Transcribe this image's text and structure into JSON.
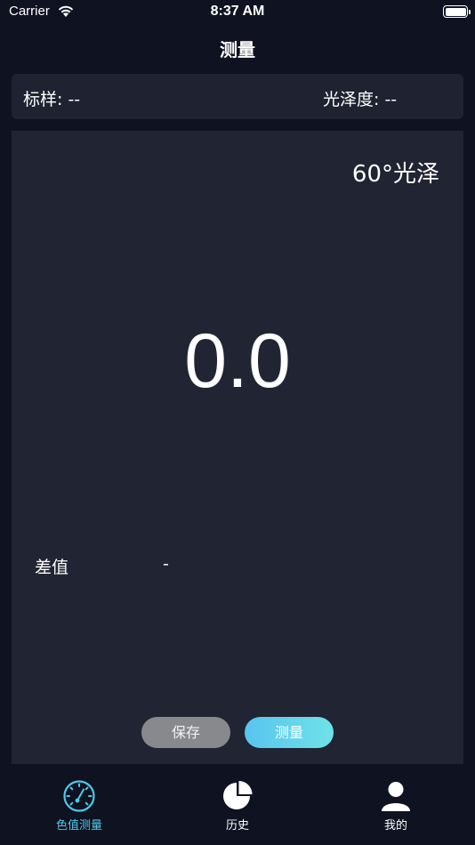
{
  "status_bar": {
    "carrier": "Carrier",
    "time": "8:37 AM"
  },
  "nav": {
    "title": "测量"
  },
  "info": {
    "sample": "标样: --",
    "gloss": "光泽度: --"
  },
  "panel": {
    "mode": "60°光泽",
    "value": "0.0",
    "diff_label": "差值",
    "diff_value": "-"
  },
  "buttons": {
    "save": "保存",
    "measure": "测量"
  },
  "tabs": [
    {
      "label": "色值测量",
      "icon": "gauge-icon",
      "active": true
    },
    {
      "label": "历史",
      "icon": "pie-chart-icon",
      "active": false
    },
    {
      "label": "我的",
      "icon": "person-icon",
      "active": false
    }
  ],
  "colors": {
    "background": "#0f1220",
    "panel": "#212432",
    "accent": "#4fc8e8",
    "save_button": "#88898d"
  }
}
